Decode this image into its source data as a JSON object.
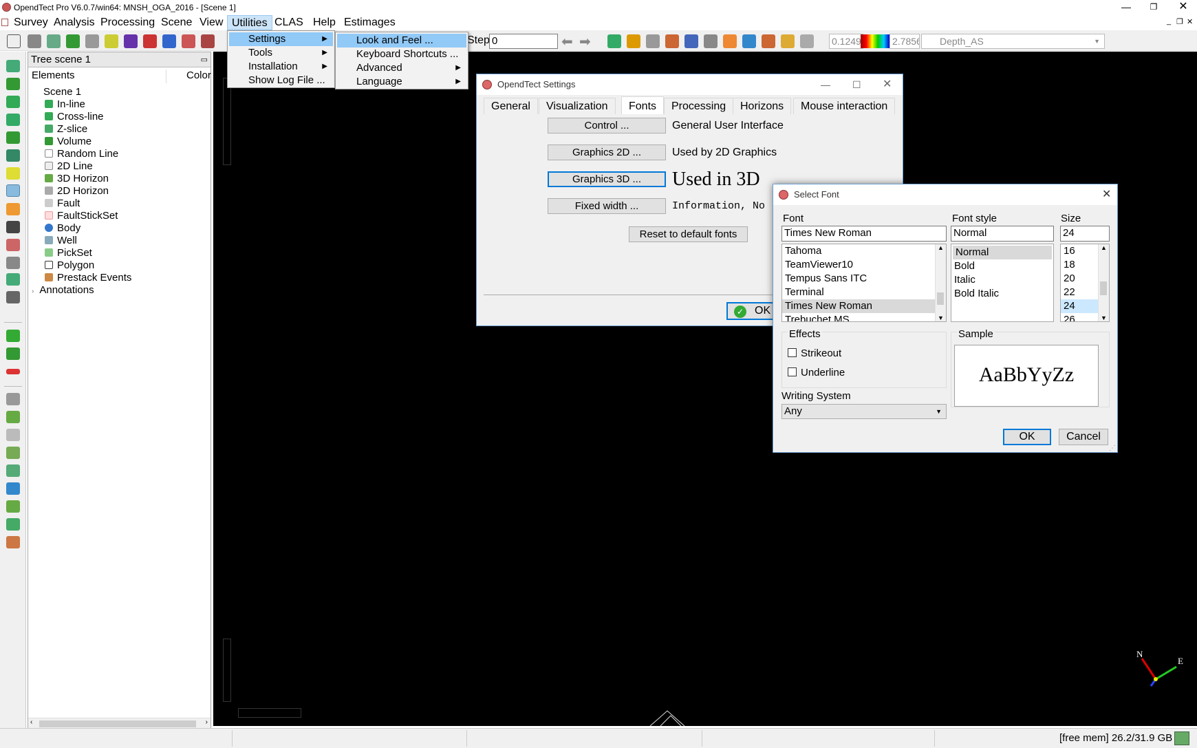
{
  "window": {
    "title": "OpendTect Pro V6.0.7/win64: MNSH_OGA_2016 - [Scene 1]"
  },
  "menubar": [
    "Survey",
    "Analysis",
    "Processing",
    "Scene",
    "View",
    "Utilities",
    "CLAS",
    "Help",
    "Estimages"
  ],
  "toolbar": {
    "step_label": "Step",
    "step_value": "0",
    "color_min": "0.1249",
    "color_max": "2.7856",
    "attribute": "Depth_AS"
  },
  "tree": {
    "title": "Tree scene 1",
    "col_elements": "Elements",
    "col_color": "Color",
    "root": "Scene 1",
    "items": [
      "In-line",
      "Cross-line",
      "Z-slice",
      "Volume",
      "Random Line",
      "2D Line",
      "3D Horizon",
      "2D Horizon",
      "Fault",
      "FaultStickSet",
      "Body",
      "Well",
      "PickSet",
      "Polygon",
      "Prestack Events"
    ],
    "annotations": "Annotations"
  },
  "utilities_menu": [
    "Settings",
    "Tools",
    "Installation",
    "Show Log File ..."
  ],
  "settings_menu": [
    "Look and Feel ...",
    "Keyboard Shortcuts ...",
    "Advanced",
    "Language"
  ],
  "settings_dialog": {
    "title": "OpendTect Settings",
    "tabs": [
      "General",
      "Visualization",
      "Fonts",
      "Processing",
      "Horizons",
      "Mouse interaction"
    ],
    "font_rows": [
      {
        "button": "Control ...",
        "desc": "General User Interface"
      },
      {
        "button": "Graphics 2D ...",
        "desc": "Used by 2D Graphics"
      },
      {
        "button": "Graphics 3D ...",
        "desc": "Used in 3D"
      },
      {
        "button": "Fixed width ...",
        "desc": "Information, No"
      }
    ],
    "reset_label": "Reset to default fonts",
    "ok_label": "OK"
  },
  "font_dialog": {
    "title": "Select Font",
    "font_label": "Font",
    "font_value": "Times New Roman",
    "fonts": [
      "Tahoma",
      "TeamViewer10",
      "Tempus Sans ITC",
      "Terminal",
      "Times New Roman",
      "Trebuchet MS"
    ],
    "style_label": "Font style",
    "style_value": "Normal",
    "styles": [
      "Normal",
      "Bold",
      "Italic",
      "Bold Italic"
    ],
    "size_label": "Size",
    "size_value": "24",
    "sizes": [
      "16",
      "18",
      "20",
      "22",
      "24",
      "26"
    ],
    "effects_label": "Effects",
    "strikeout": "Strikeout",
    "underline": "Underline",
    "sample_label": "Sample",
    "sample_text": "AaBbYyZz",
    "writing_label": "Writing System",
    "writing_value": "Any",
    "ok_label": "OK",
    "cancel_label": "Cancel"
  },
  "compass": {
    "n": "N",
    "e": "E"
  },
  "status": {
    "mem": "[free mem] 26.2/31.9 GB"
  }
}
